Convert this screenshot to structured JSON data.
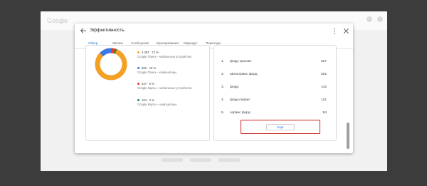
{
  "dialog": {
    "title": "Эффективность",
    "tabs": [
      {
        "label": "Обзор"
      },
      {
        "label": "Звонки"
      },
      {
        "label": "Сообщения"
      },
      {
        "label": "Бронирования"
      },
      {
        "label": "Маршрут"
      },
      {
        "label": "Переходы"
      }
    ]
  },
  "views": {
    "items": [
      {
        "value": "3 387 · 73 %",
        "label": "Google Поиск – мобильные устройства",
        "color": "#f4a025"
      },
      {
        "value": "860 · 19 %",
        "label": "Google Поиск – компьютеры",
        "color": "#3b78e7"
      },
      {
        "value": "227 · 5 %",
        "label": "Google Карты – мобильные устройства",
        "color": "#e53935"
      },
      {
        "value": "104 · 2 %",
        "label": "Google Карты – компьютеры",
        "color": "#1e8e3e"
      }
    ]
  },
  "queries": {
    "items": [
      {
        "rank": "1.",
        "text": "форд транзит",
        "count": "627"
      },
      {
        "rank": "2.",
        "text": "автосервис форд",
        "count": "202"
      },
      {
        "rank": "3.",
        "text": "форд",
        "count": "142"
      },
      {
        "rank": "4.",
        "text": "форд сервис",
        "count": "121"
      },
      {
        "rank": "5.",
        "text": "сервис форд",
        "count": "94"
      }
    ],
    "more_label": "Ещё"
  }
}
